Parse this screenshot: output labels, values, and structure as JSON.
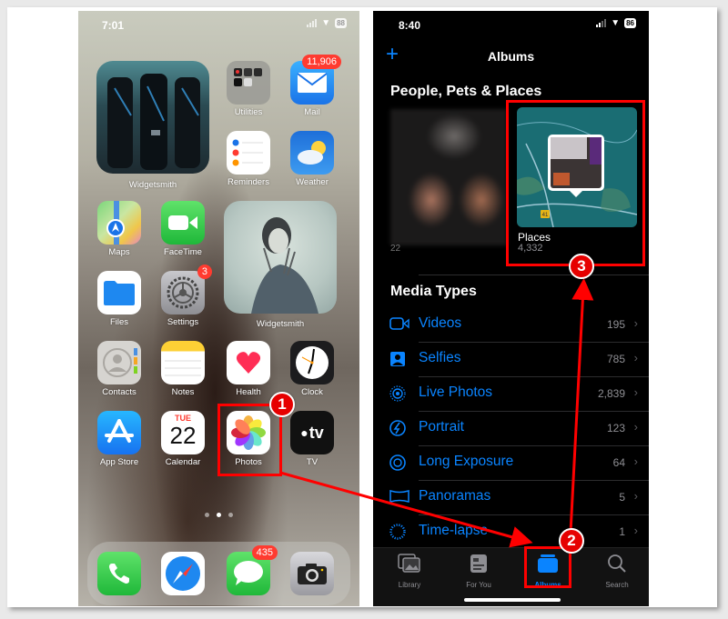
{
  "left_phone": {
    "status_bar": {
      "time": "7:01",
      "battery": "88"
    },
    "widgets": [
      {
        "label": "Widgetsmith"
      },
      {
        "label": "Widgetsmith"
      }
    ],
    "apps": [
      {
        "name": "Utilities",
        "icon": "folder-icon"
      },
      {
        "name": "Mail",
        "icon": "mail-icon",
        "badge": "11,906"
      },
      {
        "name": "Reminders",
        "icon": "reminders-icon"
      },
      {
        "name": "Weather",
        "icon": "weather-icon"
      },
      {
        "name": "Maps",
        "icon": "maps-icon"
      },
      {
        "name": "FaceTime",
        "icon": "facetime-icon"
      },
      {
        "name": "Files",
        "icon": "files-icon"
      },
      {
        "name": "Settings",
        "icon": "gear-icon",
        "badge": "3"
      },
      {
        "name": "Contacts",
        "icon": "contacts-icon"
      },
      {
        "name": "Notes",
        "icon": "notes-icon"
      },
      {
        "name": "Health",
        "icon": "heart-icon"
      },
      {
        "name": "Clock",
        "icon": "clock-icon"
      },
      {
        "name": "App Store",
        "icon": "app-store-icon"
      },
      {
        "name": "Calendar",
        "icon": "calendar-icon",
        "weekday": "TUE",
        "day": "22"
      },
      {
        "name": "Photos",
        "icon": "photos-icon"
      },
      {
        "name": "TV",
        "icon": "apple-tv-icon",
        "glyph": "tv"
      }
    ],
    "page_dots": {
      "count": 3,
      "active": 2
    },
    "dock": [
      {
        "name": "Phone",
        "icon": "phone-icon"
      },
      {
        "name": "Safari",
        "icon": "safari-icon"
      },
      {
        "name": "Messages",
        "icon": "messages-icon",
        "badge": "435"
      },
      {
        "name": "Camera",
        "icon": "camera-icon"
      }
    ]
  },
  "right_phone": {
    "status_bar": {
      "time": "8:40",
      "battery": "86"
    },
    "nav": {
      "title": "Albums",
      "add_icon": "plus-icon"
    },
    "people_section": {
      "title": "People, Pets & Places",
      "people_count": "22",
      "places_label": "Places",
      "places_count": "4,332",
      "map_marker": "41"
    },
    "media_types": {
      "title": "Media Types",
      "items": [
        {
          "label": "Videos",
          "count": "195",
          "icon": "video-icon"
        },
        {
          "label": "Selfies",
          "count": "785",
          "icon": "selfie-icon"
        },
        {
          "label": "Live Photos",
          "count": "2,839",
          "icon": "live-photo-icon"
        },
        {
          "label": "Portrait",
          "count": "123",
          "icon": "portrait-icon"
        },
        {
          "label": "Long Exposure",
          "count": "64",
          "icon": "long-exposure-icon"
        },
        {
          "label": "Panoramas",
          "count": "5",
          "icon": "panorama-icon"
        },
        {
          "label": "Time-lapse",
          "count": "1",
          "icon": "timelapse-icon"
        }
      ]
    },
    "tabs": [
      {
        "label": "Library",
        "icon": "library-icon",
        "active": false
      },
      {
        "label": "For You",
        "icon": "for-you-icon",
        "active": false
      },
      {
        "label": "Albums",
        "icon": "albums-icon",
        "active": true
      },
      {
        "label": "Search",
        "icon": "search-icon",
        "active": false
      }
    ]
  },
  "annotations": {
    "steps": [
      "1",
      "2",
      "3"
    ],
    "color": "#ff0000"
  }
}
